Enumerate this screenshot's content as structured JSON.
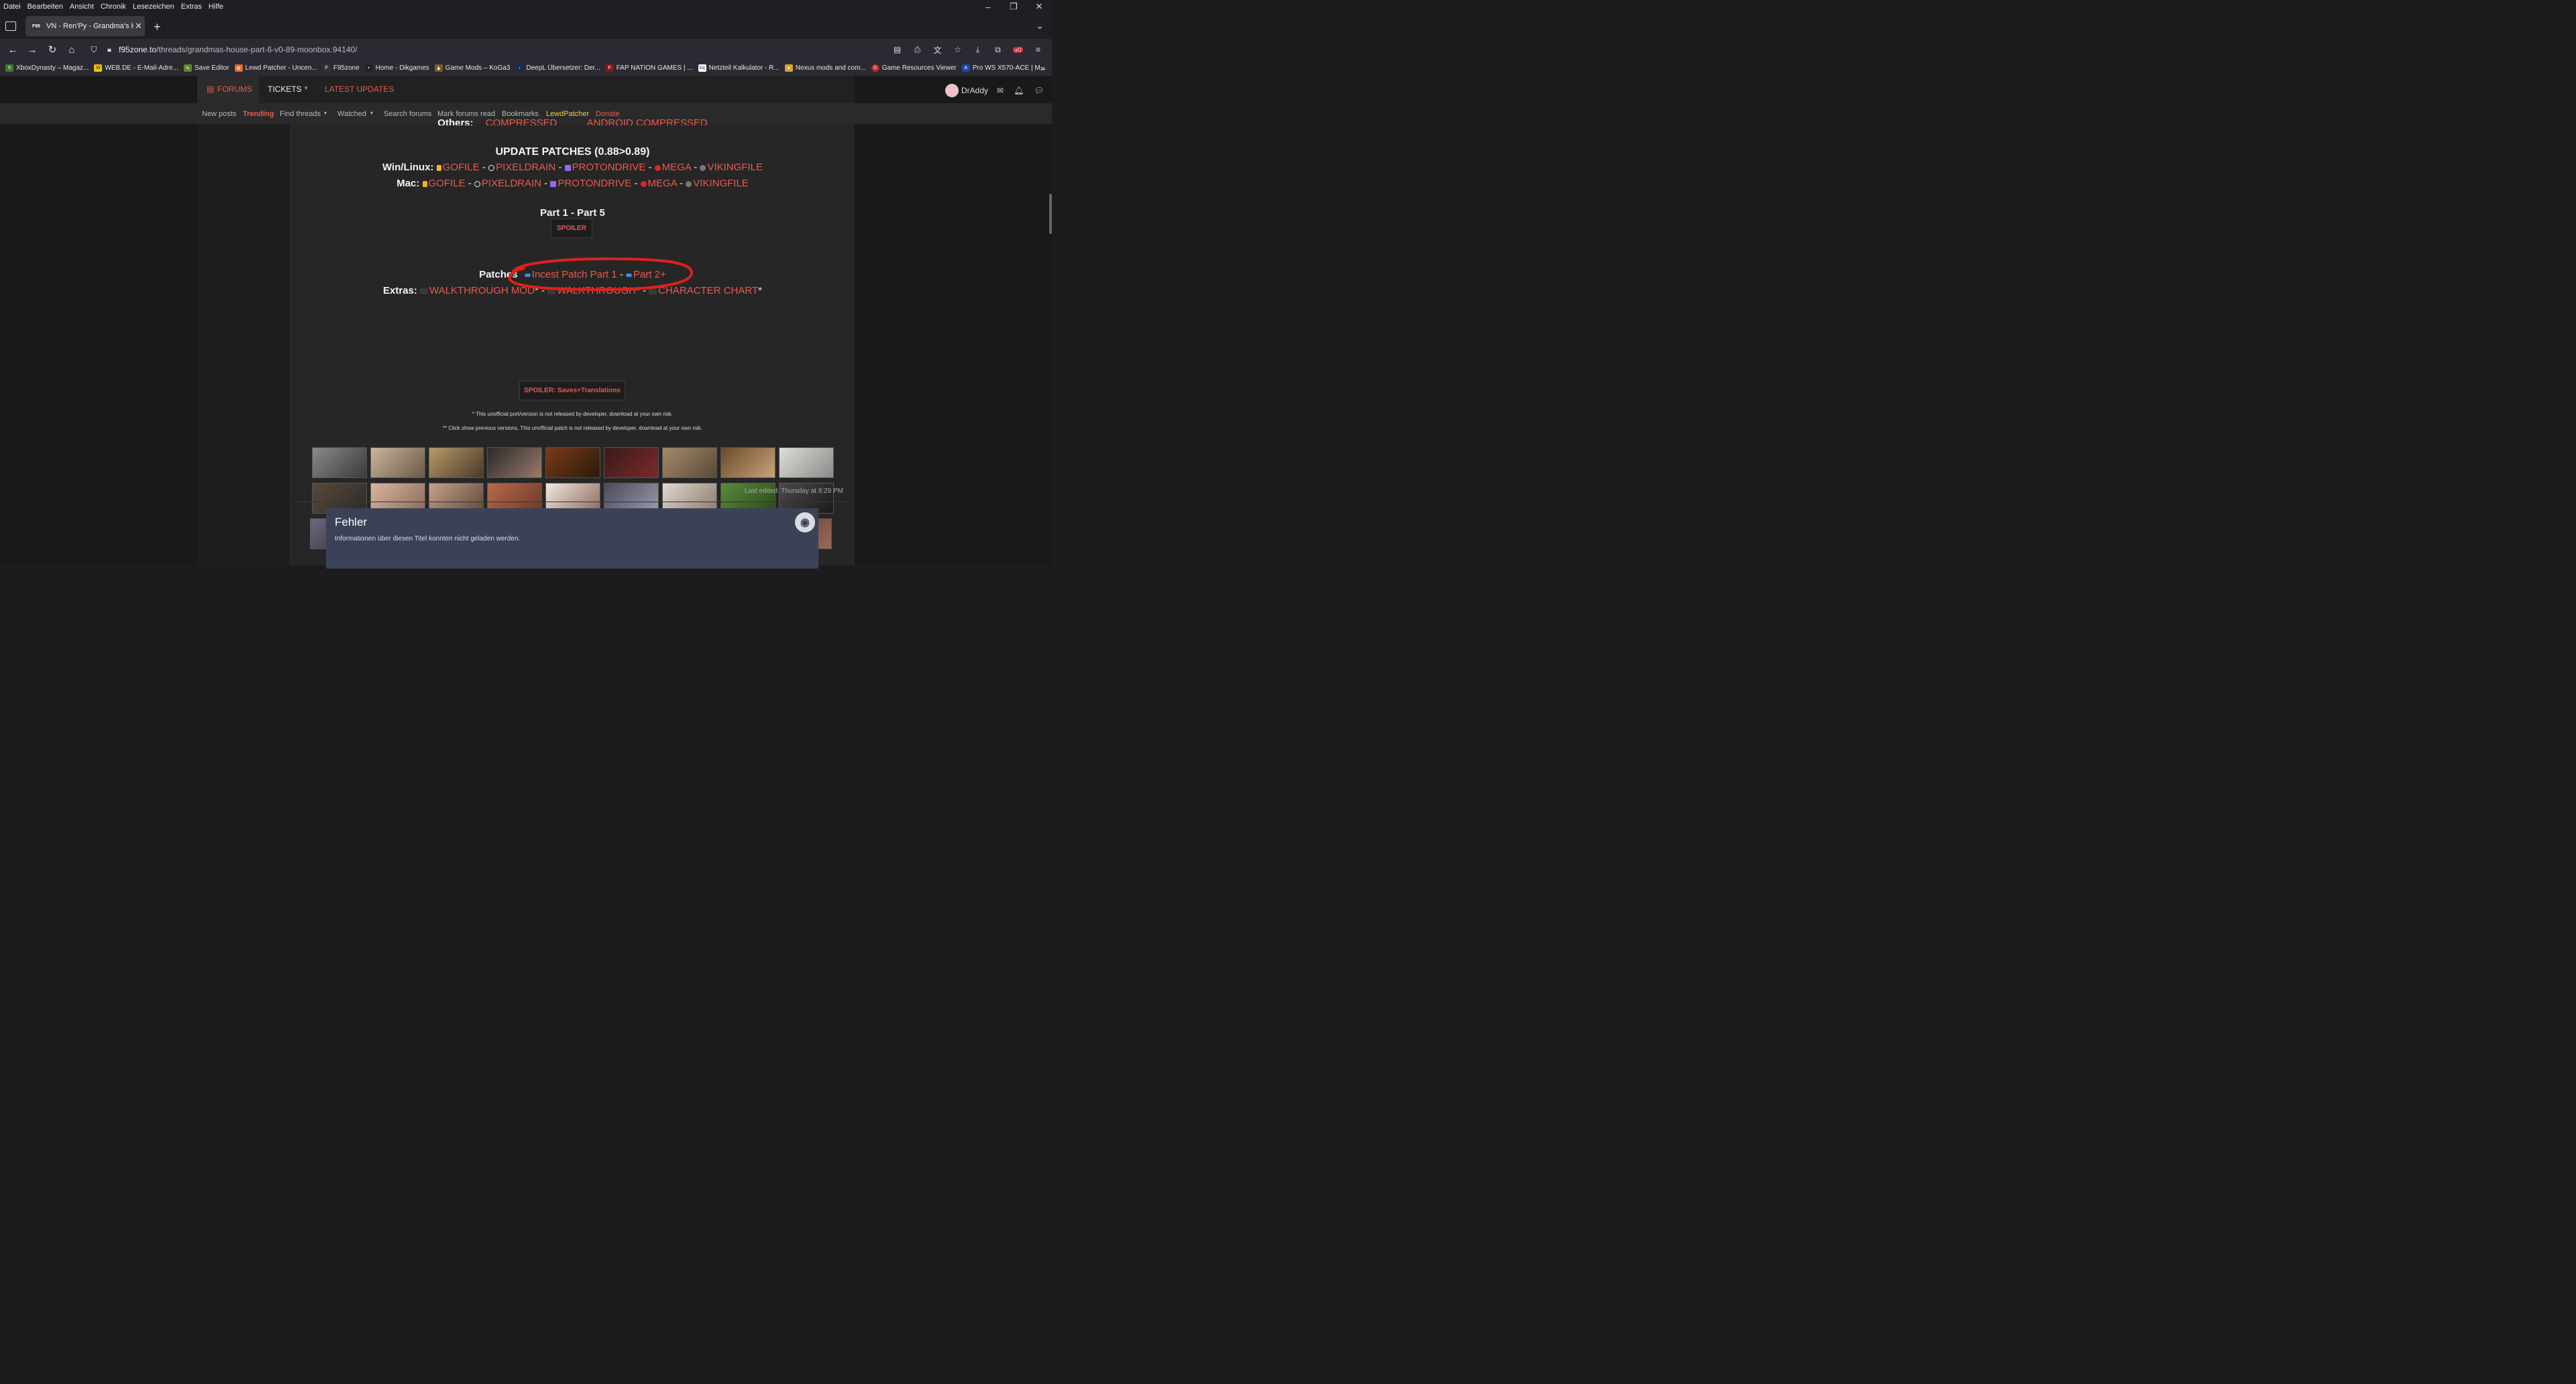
{
  "menu": [
    "Datei",
    "Bearbeiten",
    "Ansicht",
    "Chronik",
    "Lesezeichen",
    "Extras",
    "Hilfe"
  ],
  "tab": {
    "title": "VN - Ren'Py - Grandma's House"
  },
  "address": {
    "host": "f95zone.to",
    "path": "/threads/grandmas-house-part-6-v0-89-moonbox.94140/"
  },
  "bookmarks": [
    "XboxDynasty – Magaz...",
    "WEB.DE - E-Mail-Adre...",
    "Save Editor",
    "Lewd Patcher - Uncen...",
    "F95zone",
    "Home - Dikgames",
    "Game Mods – KoGa3",
    "DeepL Übersetzer: Der...",
    "FAP NATION GAMES | ...",
    "Netzteil Kalkulator - R...",
    "Nexus mods and com...",
    "Game Resources Viewer",
    "Pro WS X570-ACE | M..."
  ],
  "site": {
    "forums": "FORUMS",
    "tickets": "TICKETS",
    "latest": "LATEST UPDATES",
    "user": "DrAddy",
    "subnav": [
      "New posts",
      "Trending",
      "Find threads",
      "Watched",
      "Search forums",
      "Mark forums read",
      "Bookmarks",
      "LewdPatcher",
      "Donate"
    ]
  },
  "post": {
    "cutoff_left": "Others:",
    "cutoff_a": "COMPRESSED",
    "cutoff_b": "ANDROID COMPRESSED",
    "update_title": "UPDATE PATCHES (0.88>0.89)",
    "win_label": "Win/Linux",
    "mac_label": "Mac",
    "hosts": [
      "GOFILE",
      "PIXELDRAIN",
      "PROTONDRIVE",
      "MEGA",
      "VIKINGFILE"
    ],
    "sep": "-",
    "part_title": "Part 1 - Part 5",
    "spoiler1": "SPOILER",
    "patches_label": "Patches",
    "patch1": "Incest Patch Part 1",
    "patch2": "Part 2+",
    "extras_label": "Extras",
    "extra1": "WALKTHROUGH MOD",
    "extra2": "WALKTHROUGH",
    "extra3": "CHARACTER CHART",
    "star": "*",
    "spoiler2": "SPOILER: Saves+Translations",
    "note1": "* This unofficial port/version is not released by developer, download at your own risk.",
    "note2": "** Click show previous versions, This unofficial patch is not released by developer, download at your own risk.",
    "edited": "Last edited: Thursday at 8:29 PM"
  },
  "steam": {
    "title": "Fehler",
    "desc": "Informationen über diesen Titel konnten nicht geladen werden."
  },
  "colors": {
    "accent": "#e85a4f",
    "annotation": "#e0201c"
  }
}
